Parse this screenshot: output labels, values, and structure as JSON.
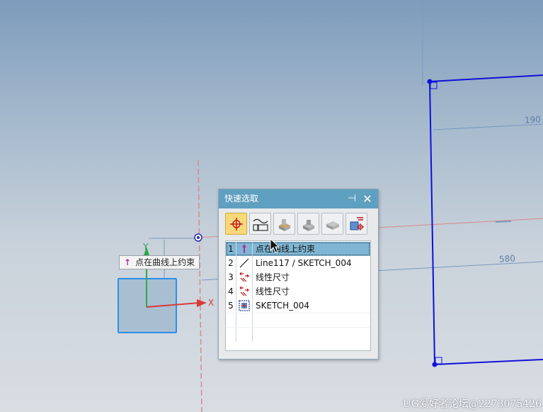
{
  "viewport": {
    "dimensions": [
      "190",
      "580"
    ],
    "axis_x_label": "X",
    "axis_y_label": "Y"
  },
  "tooltip": {
    "text": "点在曲线上约束"
  },
  "dialog": {
    "title": "快速选取",
    "pin_icon": "pin-icon",
    "close_icon": "close-icon",
    "toolbar": [
      {
        "name": "point-filter-button",
        "icon": "crosshair-icon",
        "active": true
      },
      {
        "name": "curve-filter-button",
        "icon": "curve-icon",
        "active": false
      },
      {
        "name": "face-filter-button",
        "icon": "face-icon",
        "active": false
      },
      {
        "name": "feature-filter-button",
        "icon": "feature-icon",
        "active": false
      },
      {
        "name": "body-filter-button",
        "icon": "body-icon",
        "active": false
      },
      {
        "name": "constraint-filter-button",
        "icon": "constraint-icon",
        "active": false
      }
    ],
    "items": [
      {
        "num": "1",
        "icon": "point-on-curve-icon",
        "text": "点在曲线上约束"
      },
      {
        "num": "2",
        "icon": "line-icon",
        "text": "Line117 / SKETCH_004"
      },
      {
        "num": "3",
        "icon": "dimension-icon",
        "text": "线性尺寸"
      },
      {
        "num": "4",
        "icon": "dimension-icon",
        "text": "线性尺寸"
      },
      {
        "num": "5",
        "icon": "sketch-icon",
        "text": "SKETCH_004"
      }
    ]
  },
  "watermark": "UG爱好者论坛@2273075426",
  "colors": {
    "accent": "#5f9fbf",
    "selection": "#7fb6d4",
    "sketch_line": "#1010d8",
    "construction": "#d98a8a"
  }
}
